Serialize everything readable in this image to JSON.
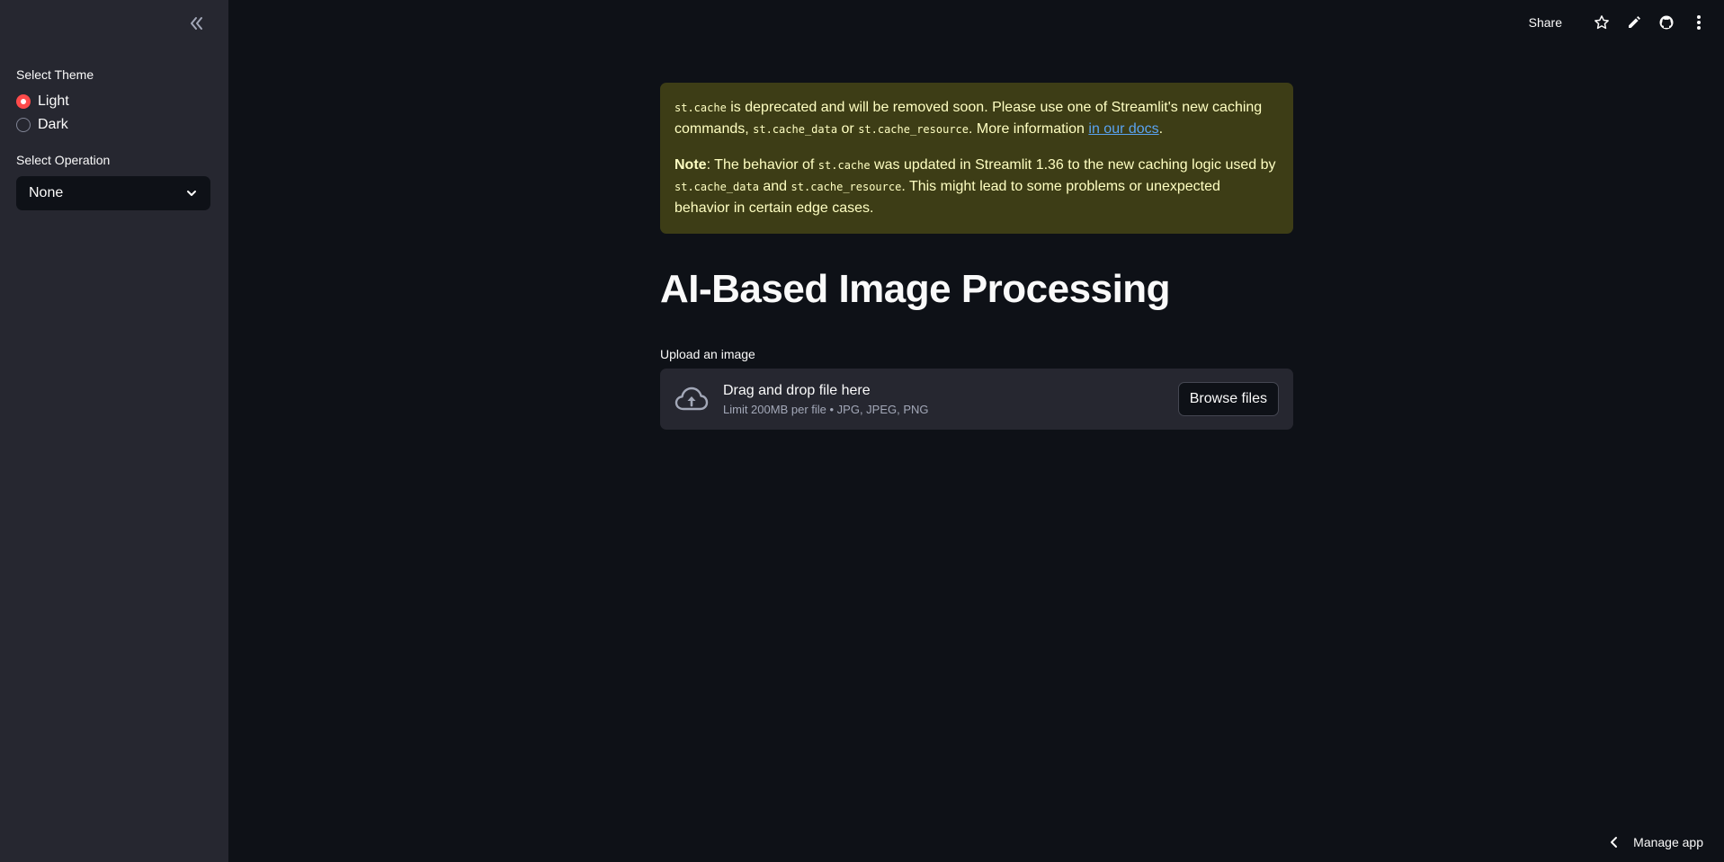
{
  "sidebar": {
    "theme_label": "Select Theme",
    "theme_options": [
      "Light",
      "Dark"
    ],
    "theme_selected": "Light",
    "operation_label": "Select Operation",
    "operation_value": "None"
  },
  "toolbar": {
    "share_label": "Share"
  },
  "alert": {
    "p1_code1": "st.cache",
    "p1_t1": " is deprecated and will be removed soon. Please use one of Streamlit's new caching commands, ",
    "p1_code2": "st.cache_data",
    "p1_t2": " or ",
    "p1_code3": "st.cache_resource",
    "p1_t3": ". More information ",
    "p1_link": "in our docs",
    "p1_t4": ".",
    "p2_bold": "Note",
    "p2_t1": ": The behavior of ",
    "p2_code1": "st.cache",
    "p2_t2": " was updated in Streamlit 1.36 to the new caching logic used by ",
    "p2_code2": "st.cache_data",
    "p2_t3": " and ",
    "p2_code3": "st.cache_resource",
    "p2_t4": ". This might lead to some problems or unexpected behavior in certain edge cases."
  },
  "main": {
    "title": "AI-Based Image Processing",
    "upload_label": "Upload an image",
    "dropzone_title": "Drag and drop file here",
    "dropzone_subtitle": "Limit 200MB per file • JPG, JPEG, PNG",
    "browse_label": "Browse files"
  },
  "footer": {
    "manage_label": "Manage app"
  },
  "colors": {
    "background": "#0e1117",
    "sidebar": "#262730",
    "accent": "#ff4b4b",
    "warning_bg": "#3d3d16",
    "warning_text": "#ffffc2",
    "link": "#5aa3f0"
  },
  "icons": {
    "collapse": "double-chevron-left-icon",
    "star": "star-icon",
    "edit": "pencil-icon",
    "github": "github-icon",
    "menu": "kebab-menu-icon",
    "upload": "cloud-upload-icon",
    "dropdown": "chevron-down-icon",
    "manage": "chevron-left-icon"
  }
}
